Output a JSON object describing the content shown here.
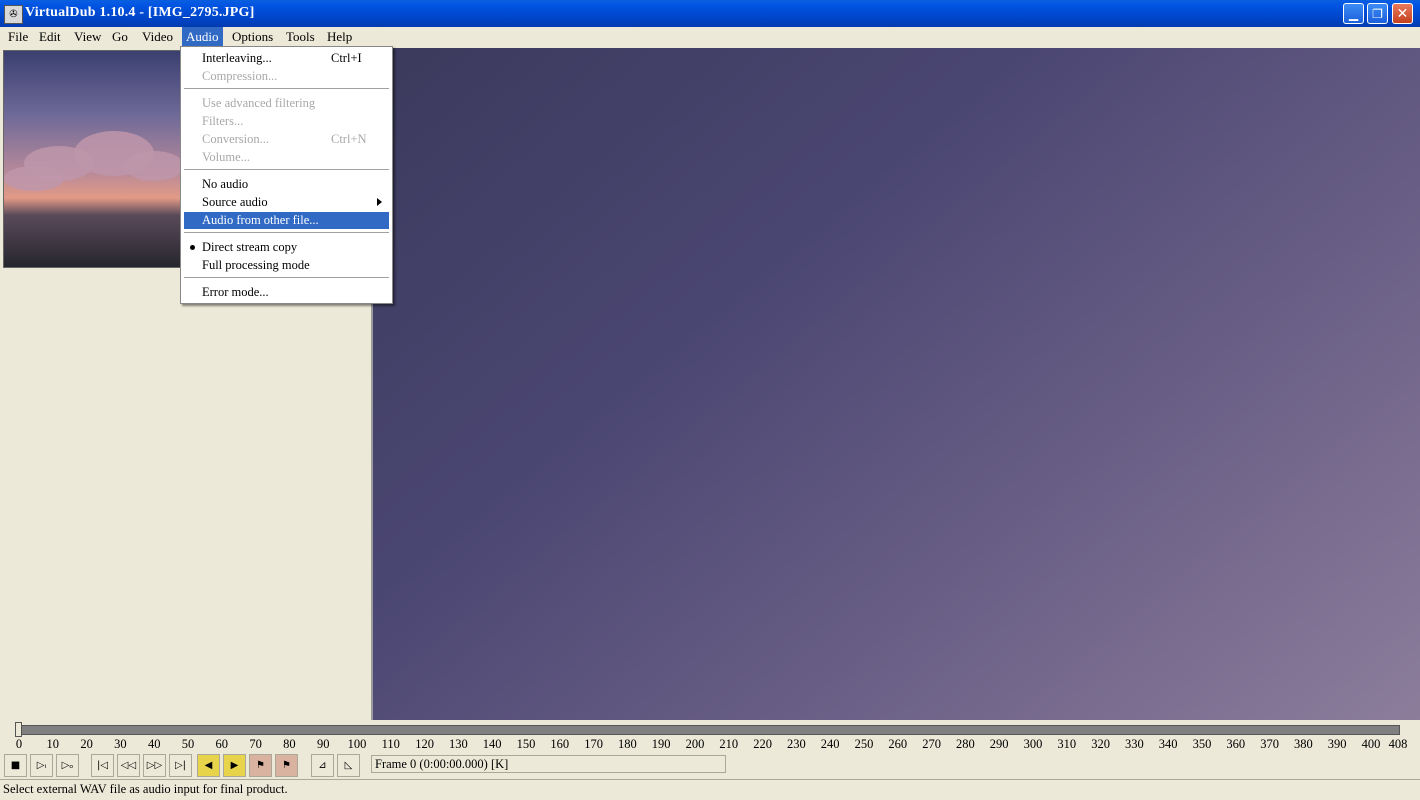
{
  "window": {
    "title": "VirtualDub 1.10.4 - [IMG_2795.JPG]",
    "icon": "app-icon",
    "buttons": [
      "minimize",
      "restore",
      "close"
    ]
  },
  "menubar": [
    "File",
    "Edit",
    "View",
    "Go",
    "Video",
    "Audio",
    "Options",
    "Tools",
    "Help"
  ],
  "active_menu": "Audio",
  "audio_menu": {
    "items": [
      {
        "label": "Interleaving...",
        "shortcut": "Ctrl+I",
        "enabled": true
      },
      {
        "label": "Compression...",
        "enabled": false
      },
      {
        "label": "Use advanced filtering",
        "enabled": false
      },
      {
        "label": "Filters...",
        "enabled": false
      },
      {
        "label": "Conversion...",
        "shortcut": "Ctrl+N",
        "enabled": false
      },
      {
        "label": "Volume...",
        "enabled": false
      },
      {
        "label": "No audio",
        "enabled": true
      },
      {
        "label": "Source audio",
        "enabled": true,
        "submenu": true
      },
      {
        "label": "Audio from other file...",
        "enabled": true,
        "highlighted": true
      },
      {
        "label": "Direct stream copy",
        "enabled": true,
        "checked": true
      },
      {
        "label": "Full processing mode",
        "enabled": true
      },
      {
        "label": "Error mode...",
        "enabled": true
      }
    ]
  },
  "timeline": {
    "ticks": [
      "0",
      "10",
      "20",
      "30",
      "40",
      "50",
      "60",
      "70",
      "80",
      "90",
      "100",
      "110",
      "120",
      "130",
      "140",
      "150",
      "160",
      "170",
      "180",
      "190",
      "200",
      "210",
      "220",
      "230",
      "240",
      "250",
      "260",
      "270",
      "280",
      "290",
      "300",
      "310",
      "320",
      "330",
      "340",
      "350",
      "360",
      "370",
      "380",
      "390",
      "400",
      "408"
    ],
    "position": 0
  },
  "toolbar": {
    "buttons": [
      "stop-icon",
      "play-input-icon",
      "play-output-icon",
      "start-icon",
      "prev-key-icon",
      "next-key-icon",
      "end-icon",
      "prev-scene-icon",
      "next-scene-icon",
      "mark-in-icon",
      "mark-out-icon",
      "mark-start-icon",
      "mark-end-icon"
    ]
  },
  "frame_display": "Frame 0 (0:00:00.000) [K]",
  "status": "Select external WAV file as audio input for final product."
}
